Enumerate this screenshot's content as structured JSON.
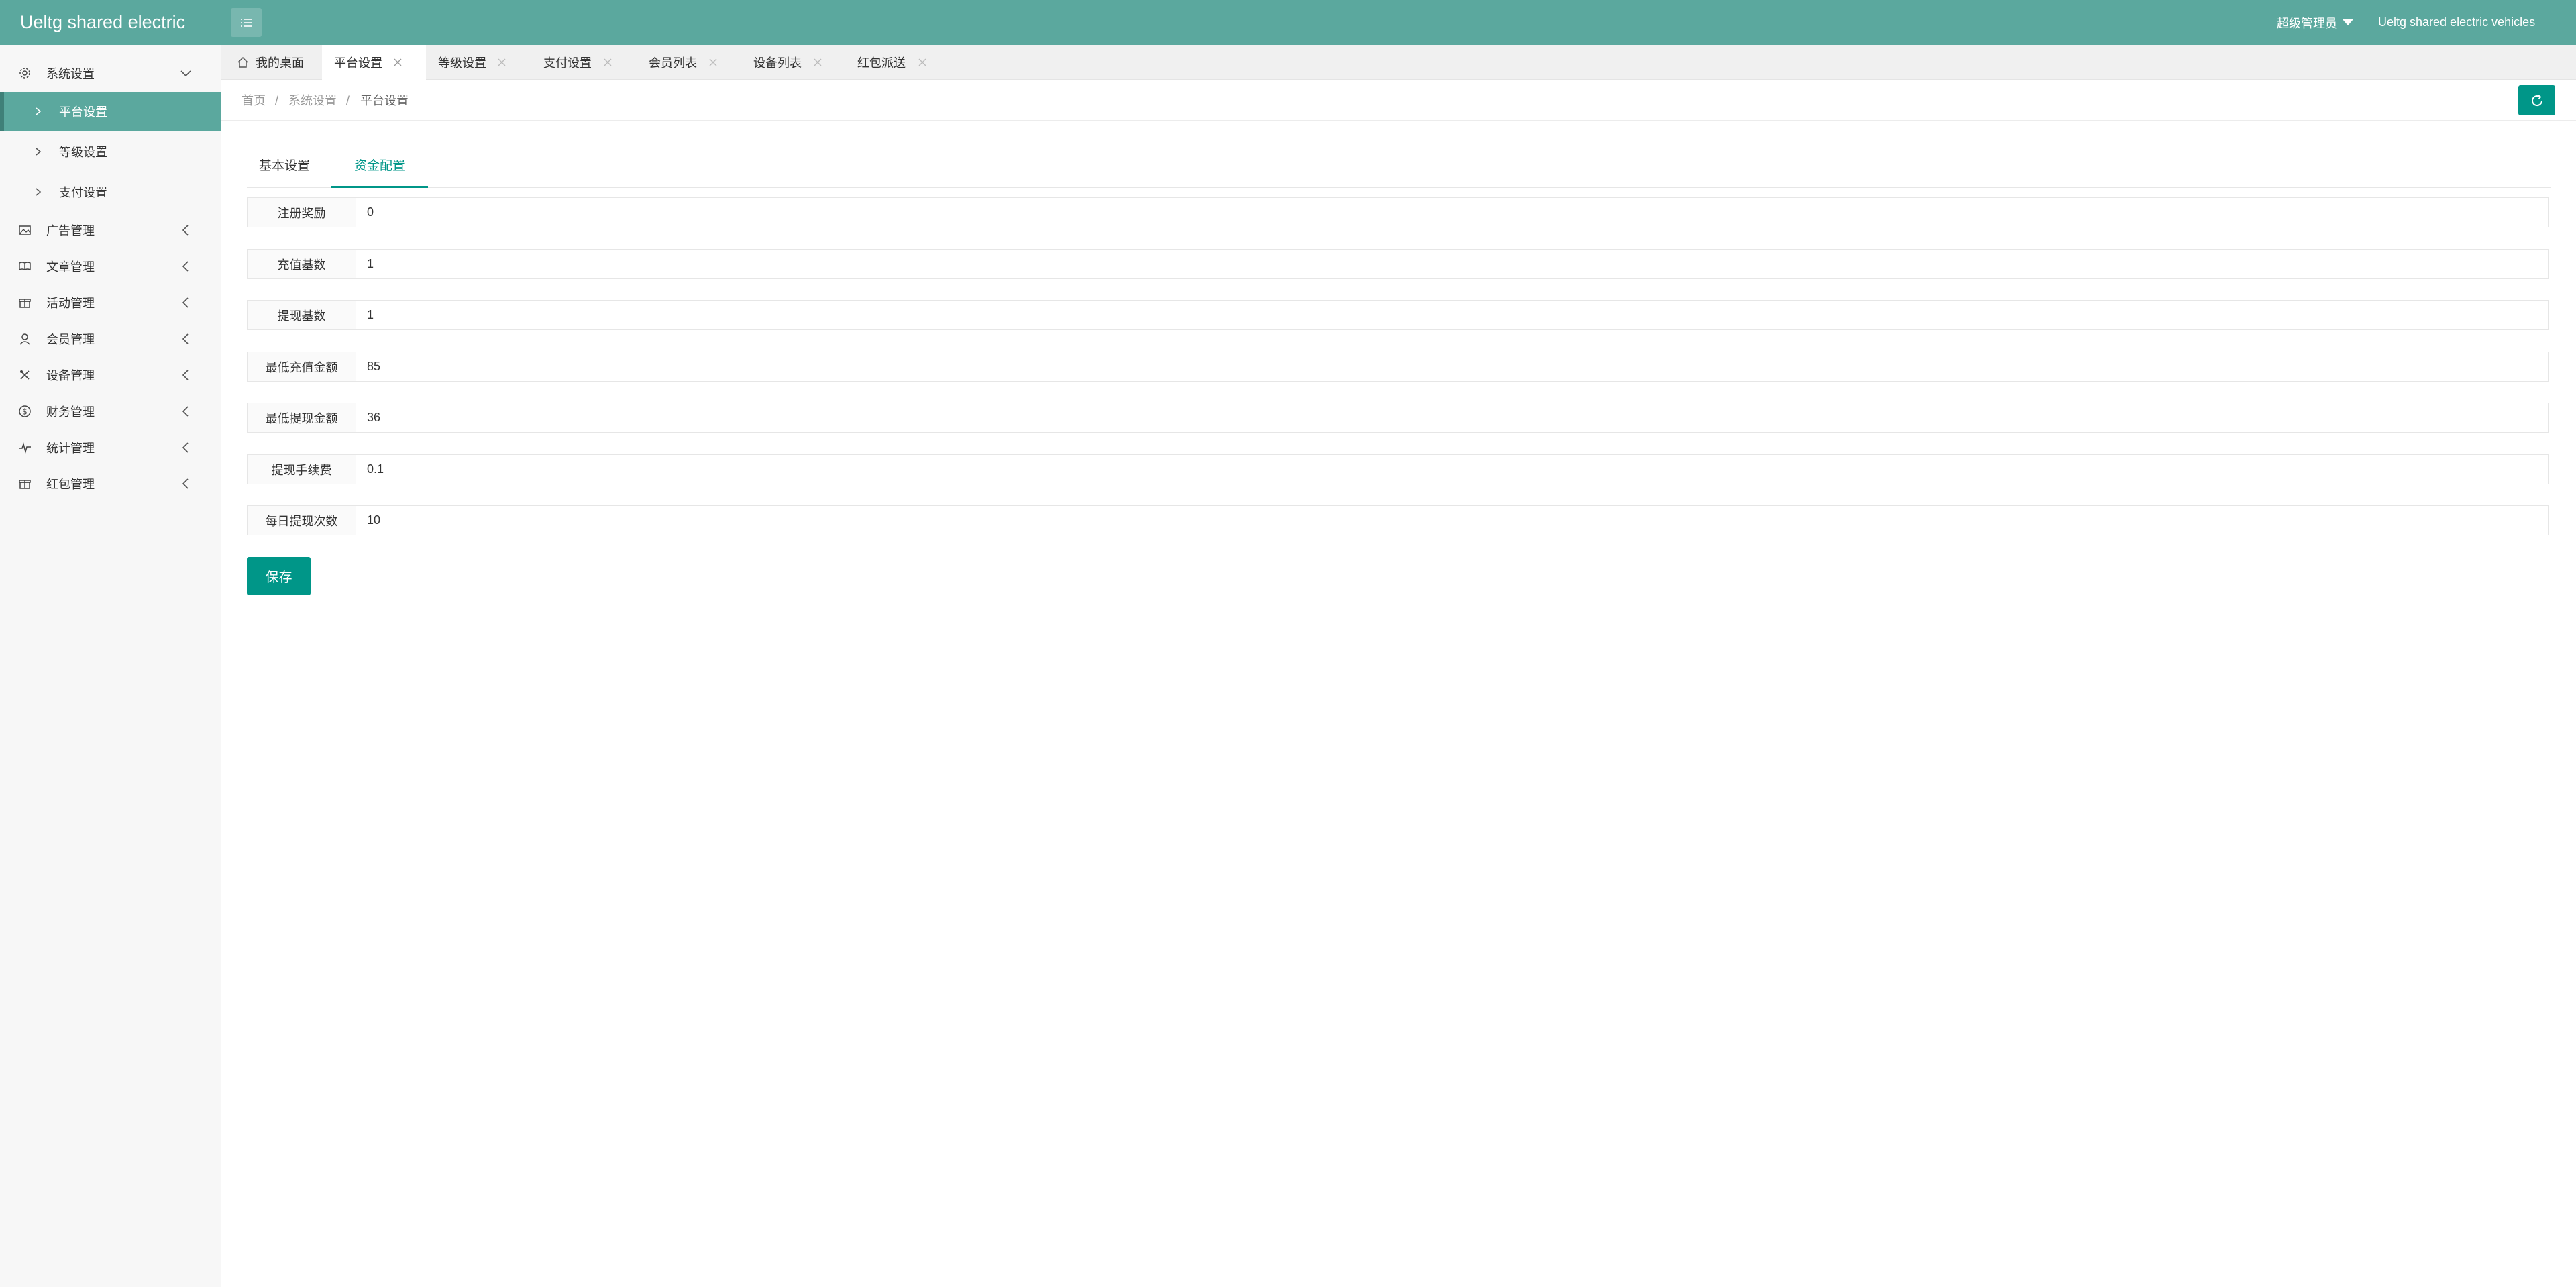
{
  "header": {
    "logo": "Ueltg shared electric",
    "admin": "超级管理员",
    "brand": "Ueltg shared electric vehicles"
  },
  "sidebar": {
    "system": "系统设置",
    "sub_items": [
      "平台设置",
      "等级设置",
      "支付设置"
    ],
    "items": [
      "广告管理",
      "文章管理",
      "活动管理",
      "会员管理",
      "设备管理",
      "财务管理",
      "统计管理",
      "红包管理"
    ]
  },
  "page_tabs": [
    "我的桌面",
    "平台设置",
    "等级设置",
    "支付设置",
    "会员列表",
    "设备列表",
    "红包派送"
  ],
  "breadcrumb": [
    "首页",
    "系统设置",
    "平台设置"
  ],
  "breadcrumb_sep": "/",
  "content_tabs": [
    "基本设置",
    "资金配置"
  ],
  "form": [
    {
      "label": "注册奖励",
      "value": "0"
    },
    {
      "label": "充值基数",
      "value": "1"
    },
    {
      "label": "提现基数",
      "value": "1"
    },
    {
      "label": "最低充值金额",
      "value": "85"
    },
    {
      "label": "最低提现金额",
      "value": "36"
    },
    {
      "label": "提现手续费",
      "value": "0.1"
    },
    {
      "label": "每日提现次数",
      "value": "10"
    }
  ],
  "save_label": "保存",
  "colors": {
    "header": "#5ba89e",
    "accent": "#009688",
    "sidebar_active": "#5ba89e"
  }
}
